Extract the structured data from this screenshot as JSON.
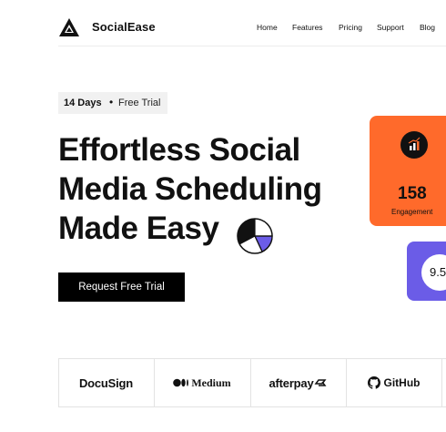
{
  "header": {
    "brand": "SocialEase",
    "nav": [
      "Home",
      "Features",
      "Pricing",
      "Support",
      "Blog"
    ]
  },
  "hero": {
    "badge_days": "14 Days",
    "badge_separator": "•",
    "badge_trial": "Free Trial",
    "heading_lines": [
      "Effortless Social",
      "Media Scheduling",
      "Made Easy"
    ],
    "cta_label": "Request Free Trial"
  },
  "stats": {
    "engagement_value": "158",
    "engagement_label": "Engagement",
    "rating_value": "9.5"
  },
  "partners": [
    "DocuSign",
    "Medium",
    "afterpay",
    "GitHub"
  ],
  "colors": {
    "accent_orange": "#ff6a2b",
    "accent_purple": "#6b5ce7",
    "cta_background": "#000000"
  },
  "icons": {
    "logo": "triangle-logo-icon",
    "engagement": "bar-chart-trend-icon",
    "heading": "pie-chart-icon",
    "medium": "medium-icon",
    "afterpay": "afterpay-arrows-icon",
    "github": "github-icon"
  }
}
